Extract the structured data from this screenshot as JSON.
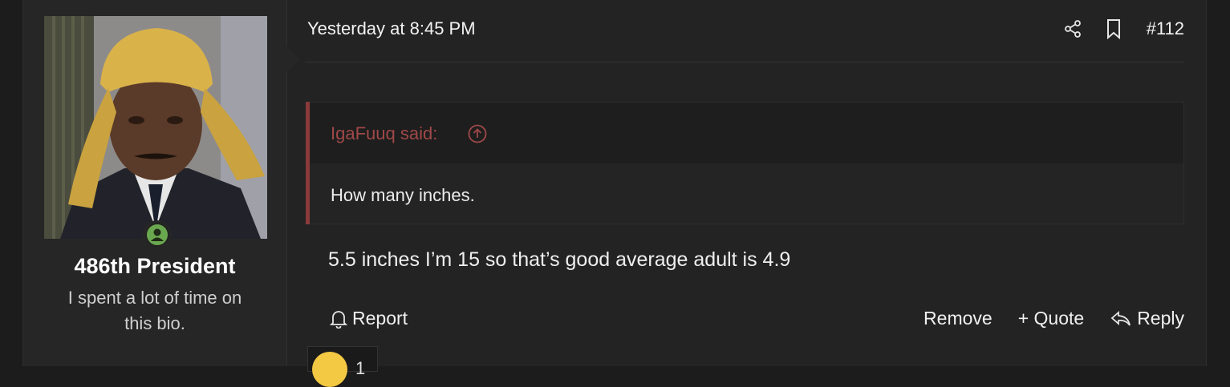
{
  "user": {
    "name": "486th President",
    "bio": "I spent a lot of time on this bio."
  },
  "post": {
    "date": "Yesterday at 8:45 PM",
    "number": "#112",
    "message": "5.5 inches I’m 15 so that’s good average adult is 4.9"
  },
  "quote": {
    "author": "IgaFuuq said:",
    "text": "How many inches."
  },
  "actions": {
    "report": "Report",
    "remove": "Remove",
    "quote": "+ Quote",
    "reply": "Reply"
  },
  "reaction": {
    "count": "1"
  },
  "colors": {
    "quote_accent": "#a04848",
    "online": "#6aa84f"
  }
}
